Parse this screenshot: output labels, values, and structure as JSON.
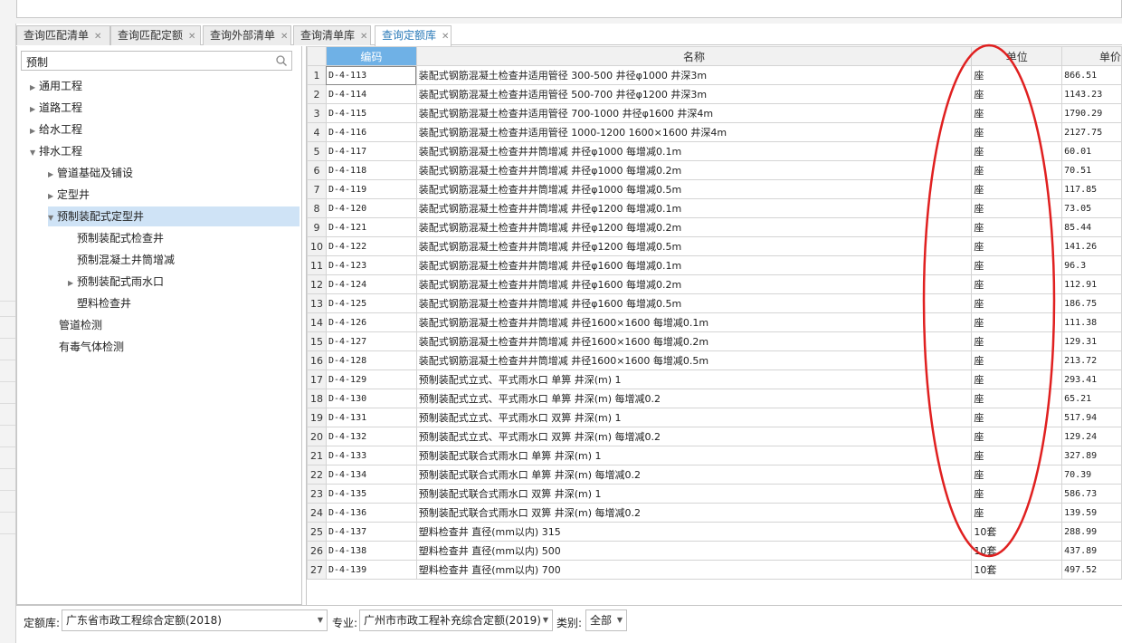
{
  "tabs": [
    {
      "label": "查询匹配清单",
      "active": false
    },
    {
      "label": "查询匹配定额",
      "active": false
    },
    {
      "label": "查询外部清单",
      "active": false
    },
    {
      "label": "查询清单库",
      "active": false
    },
    {
      "label": "查询定额库",
      "active": true
    }
  ],
  "search": {
    "value": "预制"
  },
  "tree": [
    {
      "label": "通用工程",
      "expanded": false
    },
    {
      "label": "道路工程",
      "expanded": false
    },
    {
      "label": "给水工程",
      "expanded": false
    },
    {
      "label": "排水工程",
      "expanded": true
    },
    {
      "label": "管道基础及铺设",
      "expanded": false
    },
    {
      "label": "定型井",
      "expanded": false
    },
    {
      "label": "预制装配式定型井",
      "expanded": true,
      "selected": true
    },
    {
      "label": "预制装配式检查井"
    },
    {
      "label": "预制混凝土井筒增减"
    },
    {
      "label": "预制装配式雨水口",
      "expanded": false
    },
    {
      "label": "塑料检查井"
    },
    {
      "label": "管道检测"
    },
    {
      "label": "有毒气体检测"
    }
  ],
  "grid": {
    "headers": {
      "code": "编码",
      "name": "名称",
      "unit": "单位",
      "price": "单价"
    },
    "rows": [
      {
        "n": "1",
        "code": "D-4-113",
        "name": "装配式钢筋混凝土检查井适用管径 300-500 井径φ1000 井深3m",
        "unit": "座",
        "price": "866.51"
      },
      {
        "n": "2",
        "code": "D-4-114",
        "name": "装配式钢筋混凝土检查井适用管径 500-700 井径φ1200 井深3m",
        "unit": "座",
        "price": "1143.23"
      },
      {
        "n": "3",
        "code": "D-4-115",
        "name": "装配式钢筋混凝土检查井适用管径 700-1000 井径φ1600 井深4m",
        "unit": "座",
        "price": "1790.29"
      },
      {
        "n": "4",
        "code": "D-4-116",
        "name": "装配式钢筋混凝土检查井适用管径 1000-1200 1600×1600 井深4m",
        "unit": "座",
        "price": "2127.75"
      },
      {
        "n": "5",
        "code": "D-4-117",
        "name": "装配式钢筋混凝土检查井井筒增减 井径φ1000 每增减0.1m",
        "unit": "座",
        "price": "60.01"
      },
      {
        "n": "6",
        "code": "D-4-118",
        "name": "装配式钢筋混凝土检查井井筒增减 井径φ1000 每增减0.2m",
        "unit": "座",
        "price": "70.51"
      },
      {
        "n": "7",
        "code": "D-4-119",
        "name": "装配式钢筋混凝土检查井井筒增减 井径φ1000 每增减0.5m",
        "unit": "座",
        "price": "117.85"
      },
      {
        "n": "8",
        "code": "D-4-120",
        "name": "装配式钢筋混凝土检查井井筒增减 井径φ1200 每增减0.1m",
        "unit": "座",
        "price": "73.05"
      },
      {
        "n": "9",
        "code": "D-4-121",
        "name": "装配式钢筋混凝土检查井井筒增减 井径φ1200 每增减0.2m",
        "unit": "座",
        "price": "85.44"
      },
      {
        "n": "10",
        "code": "D-4-122",
        "name": "装配式钢筋混凝土检查井井筒增减 井径φ1200 每增减0.5m",
        "unit": "座",
        "price": "141.26"
      },
      {
        "n": "11",
        "code": "D-4-123",
        "name": "装配式钢筋混凝土检查井井筒增减 井径φ1600 每增减0.1m",
        "unit": "座",
        "price": "96.3"
      },
      {
        "n": "12",
        "code": "D-4-124",
        "name": "装配式钢筋混凝土检查井井筒增减 井径φ1600 每增减0.2m",
        "unit": "座",
        "price": "112.91"
      },
      {
        "n": "13",
        "code": "D-4-125",
        "name": "装配式钢筋混凝土检查井井筒增减 井径φ1600 每增减0.5m",
        "unit": "座",
        "price": "186.75"
      },
      {
        "n": "14",
        "code": "D-4-126",
        "name": "装配式钢筋混凝土检查井井筒增减 井径1600×1600 每增减0.1m",
        "unit": "座",
        "price": "111.38"
      },
      {
        "n": "15",
        "code": "D-4-127",
        "name": "装配式钢筋混凝土检查井井筒增减 井径1600×1600 每增减0.2m",
        "unit": "座",
        "price": "129.31"
      },
      {
        "n": "16",
        "code": "D-4-128",
        "name": "装配式钢筋混凝土检查井井筒增减 井径1600×1600 每增减0.5m",
        "unit": "座",
        "price": "213.72"
      },
      {
        "n": "17",
        "code": "D-4-129",
        "name": "预制装配式立式、平式雨水口 单箅 井深(m) 1",
        "unit": "座",
        "price": "293.41"
      },
      {
        "n": "18",
        "code": "D-4-130",
        "name": "预制装配式立式、平式雨水口 单箅 井深(m) 每增减0.2",
        "unit": "座",
        "price": "65.21"
      },
      {
        "n": "19",
        "code": "D-4-131",
        "name": "预制装配式立式、平式雨水口 双箅 井深(m) 1",
        "unit": "座",
        "price": "517.94"
      },
      {
        "n": "20",
        "code": "D-4-132",
        "name": "预制装配式立式、平式雨水口 双箅 井深(m) 每增减0.2",
        "unit": "座",
        "price": "129.24"
      },
      {
        "n": "21",
        "code": "D-4-133",
        "name": "预制装配式联合式雨水口 单箅 井深(m) 1",
        "unit": "座",
        "price": "327.89"
      },
      {
        "n": "22",
        "code": "D-4-134",
        "name": "预制装配式联合式雨水口 单箅 井深(m) 每增减0.2",
        "unit": "座",
        "price": "70.39"
      },
      {
        "n": "23",
        "code": "D-4-135",
        "name": "预制装配式联合式雨水口 双箅 井深(m) 1",
        "unit": "座",
        "price": "586.73"
      },
      {
        "n": "24",
        "code": "D-4-136",
        "name": "预制装配式联合式雨水口 双箅 井深(m) 每增减0.2",
        "unit": "座",
        "price": "139.59"
      },
      {
        "n": "25",
        "code": "D-4-137",
        "name": "塑料检查井 直径(mm以内) 315",
        "unit": "10套",
        "price": "288.99"
      },
      {
        "n": "26",
        "code": "D-4-138",
        "name": "塑料检查井 直径(mm以内) 500",
        "unit": "10套",
        "price": "437.89"
      },
      {
        "n": "27",
        "code": "D-4-139",
        "name": "塑料检查井 直径(mm以内) 700",
        "unit": "10套",
        "price": "497.52"
      }
    ]
  },
  "bottom": {
    "quota_label": "定额库:",
    "quota_value": "广东省市政工程综合定额(2018)",
    "major_label": "专业:",
    "major_value": "广州市市政工程补充综合定额(2019)",
    "category_label": "类别:",
    "category_value": "全部"
  },
  "annotation_color": "#e02020"
}
